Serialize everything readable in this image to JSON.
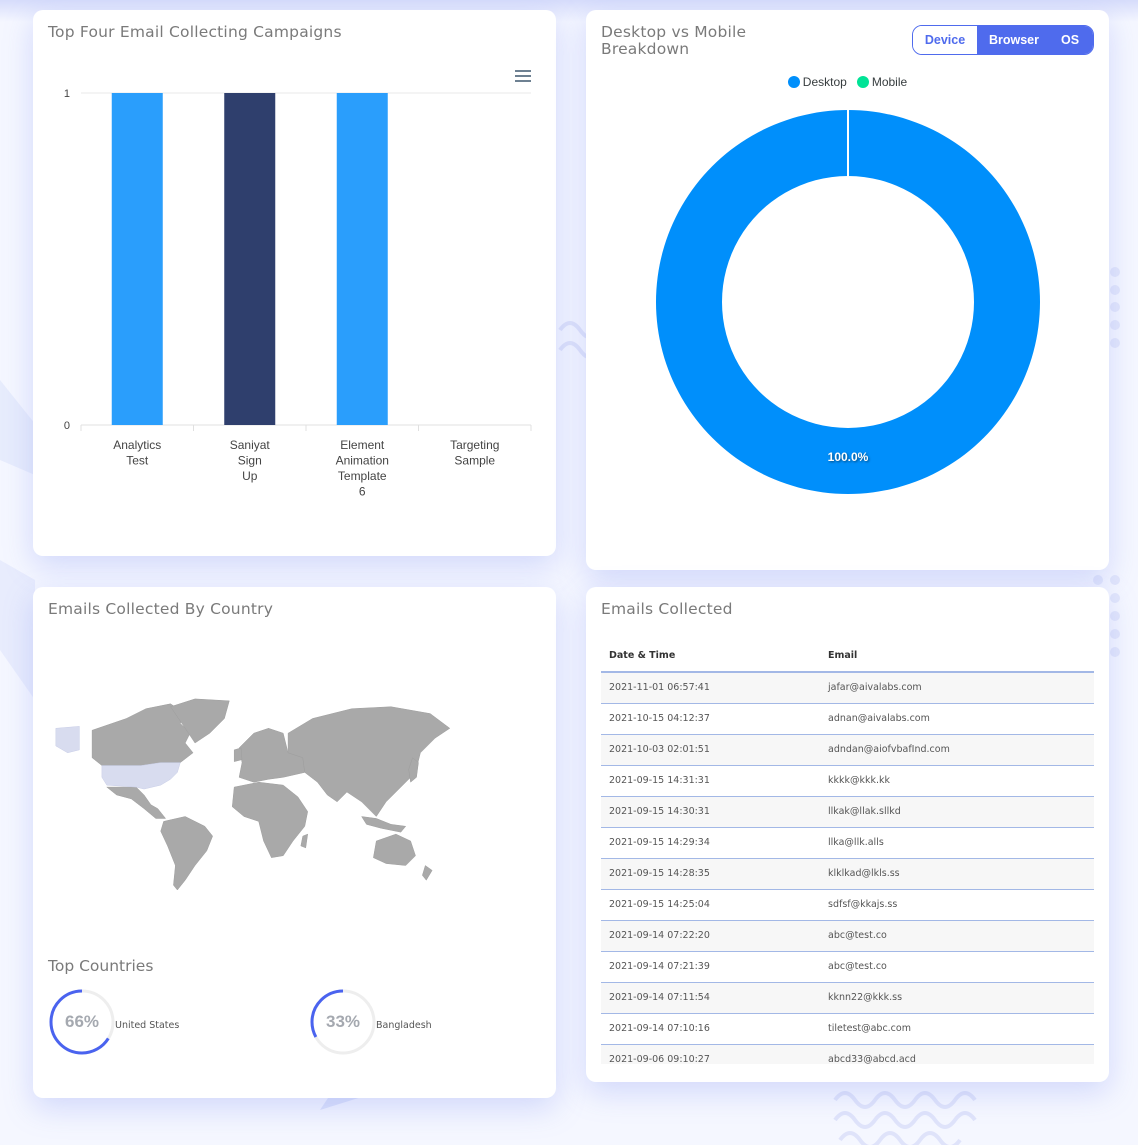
{
  "campaigns_card": {
    "title": "Top Four Email Collecting Campaigns",
    "menu_icon": "hamburger-menu-icon",
    "chart_data": {
      "type": "bar",
      "title": "Top Four Email Collecting Campaigns",
      "categories": [
        [
          "Analytics",
          "Test"
        ],
        [
          "Saniyat",
          "Sign",
          "Up"
        ],
        [
          "Element",
          "Animation",
          "Template",
          "6"
        ],
        [
          "Targeting",
          "Sample"
        ]
      ],
      "category_names": [
        "Analytics Test",
        "Saniyat Sign Up",
        "Element Animation Template 6",
        "Targeting Sample"
      ],
      "values": [
        1,
        1,
        1,
        0
      ],
      "colors": [
        "#2a9efc",
        "#2f3f6d",
        "#2a9efc",
        "#2a9efc"
      ],
      "yticks": [
        "0",
        "1"
      ],
      "ylim": [
        0,
        1
      ],
      "xlabel": "",
      "ylabel": "",
      "grid": true
    }
  },
  "device_card": {
    "title_line1": "Desktop vs Mobile",
    "title_line2": "Breakdown",
    "toggle": {
      "device": "Device",
      "browser": "Browser",
      "os": "OS",
      "selected": "Device"
    },
    "chart_data": {
      "type": "pie",
      "variant": "donut",
      "legend": [
        "Desktop",
        "Mobile"
      ],
      "legend_position": "top-center",
      "colors": [
        "#008ffb",
        "#00e396"
      ],
      "values": [
        100,
        0
      ],
      "data_labels": [
        "100.0%",
        ""
      ]
    }
  },
  "country_card": {
    "title": "Emails Collected By Country",
    "map": {
      "highlighted_country": "United States",
      "highlight_color": "#d8dcef",
      "base_color": "#a9a9a9"
    },
    "top_countries_title": "Top Countries",
    "countries": [
      {
        "name": "United States",
        "percent_label": "66%",
        "value": 66
      },
      {
        "name": "Bangladesh",
        "percent_label": "33%",
        "value": 33
      }
    ],
    "ring_color": "#4a63ef",
    "ring_track": "#eeeeee"
  },
  "emails_card": {
    "title": "Emails Collected",
    "columns": [
      "Date & Time",
      "Email"
    ],
    "rows": [
      [
        "2021-11-01 06:57:41",
        "jafar@aivalabs.com"
      ],
      [
        "2021-10-15 04:12:37",
        "adnan@aivalabs.com"
      ],
      [
        "2021-10-03 02:01:51",
        "adndan@aiofvbafInd.com"
      ],
      [
        "2021-09-15 14:31:31",
        "kkkk@kkk.kk"
      ],
      [
        "2021-09-15 14:30:31",
        "llkak@llak.sllkd"
      ],
      [
        "2021-09-15 14:29:34",
        "llka@llk.alls"
      ],
      [
        "2021-09-15 14:28:35",
        "klklkad@lkls.ss"
      ],
      [
        "2021-09-15 14:25:04",
        "sdfsf@kkajs.ss"
      ],
      [
        "2021-09-14 07:22:20",
        "abc@test.co"
      ],
      [
        "2021-09-14 07:21:39",
        "abc@test.co"
      ],
      [
        "2021-09-14 07:11:54",
        "kknn22@kkk.ss"
      ],
      [
        "2021-09-14 07:10:16",
        "tiletest@abc.com"
      ],
      [
        "2021-09-06 09:10:27",
        "abcd33@abcd.acd"
      ]
    ]
  }
}
